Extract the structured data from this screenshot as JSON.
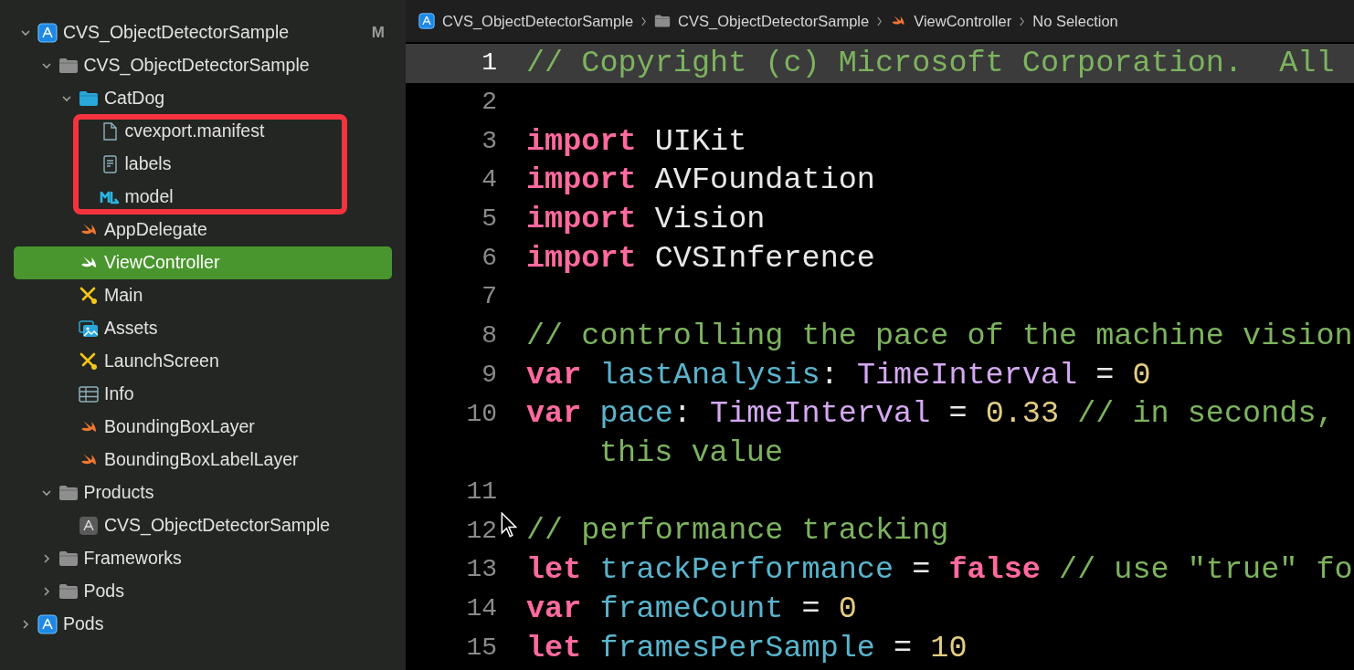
{
  "navigator": {
    "tree": [
      {
        "label": "CVS_ObjectDetectorSample",
        "kind": "app",
        "expanded": true,
        "badge": "M",
        "selected": false,
        "children": [
          {
            "label": "CVS_ObjectDetectorSample",
            "kind": "folder",
            "expanded": true,
            "selected": false,
            "children": [
              {
                "label": "CatDog",
                "kind": "group",
                "expanded": true,
                "selected": false,
                "highlighted": true,
                "children": [
                  {
                    "label": "cvexport.manifest",
                    "kind": "doc",
                    "selected": false
                  },
                  {
                    "label": "labels",
                    "kind": "textdoc",
                    "selected": false
                  },
                  {
                    "label": "model",
                    "kind": "ml",
                    "selected": false
                  }
                ]
              },
              {
                "label": "AppDelegate",
                "kind": "swift",
                "selected": false
              },
              {
                "label": "ViewController",
                "kind": "swift",
                "selected": true
              },
              {
                "label": "Main",
                "kind": "storyboard",
                "selected": false
              },
              {
                "label": "Assets",
                "kind": "assets",
                "selected": false
              },
              {
                "label": "LaunchScreen",
                "kind": "storyboard",
                "selected": false
              },
              {
                "label": "Info",
                "kind": "plist",
                "selected": false
              },
              {
                "label": "BoundingBoxLayer",
                "kind": "swift",
                "selected": false
              },
              {
                "label": "BoundingBoxLabelLayer",
                "kind": "swift",
                "selected": false
              }
            ]
          },
          {
            "label": "Products",
            "kind": "folder",
            "expanded": true,
            "selected": false,
            "children": [
              {
                "label": "CVS_ObjectDetectorSample",
                "kind": "product",
                "selected": false
              }
            ]
          },
          {
            "label": "Frameworks",
            "kind": "folder",
            "expanded": false,
            "selected": false
          },
          {
            "label": "Pods",
            "kind": "folder",
            "expanded": false,
            "selected": false
          }
        ]
      },
      {
        "label": "Pods",
        "kind": "app",
        "expanded": false,
        "selected": false
      }
    ]
  },
  "breadcrumb": [
    {
      "label": "CVS_ObjectDetectorSample",
      "kind": "app"
    },
    {
      "label": "CVS_ObjectDetectorSample",
      "kind": "folder"
    },
    {
      "label": "ViewController",
      "kind": "swift"
    },
    {
      "label": "No Selection",
      "kind": "text"
    }
  ],
  "editor": {
    "lines": [
      {
        "number": "1",
        "current": true,
        "tokens": [
          {
            "kind": "comment",
            "text": "// Copyright (c) Microsoft Corporation.  All"
          }
        ]
      },
      {
        "number": "2",
        "current": false
      },
      {
        "number": "3",
        "current": false,
        "tokens": [
          {
            "kind": "keyword",
            "text": "import"
          },
          {
            "kind": "plain",
            "text": " UIKit"
          }
        ]
      },
      {
        "number": "4",
        "current": false,
        "tokens": [
          {
            "kind": "keyword",
            "text": "import"
          },
          {
            "kind": "plain",
            "text": " AVFoundation"
          }
        ]
      },
      {
        "number": "5",
        "current": false,
        "tokens": [
          {
            "kind": "keyword",
            "text": "import"
          },
          {
            "kind": "plain",
            "text": " Vision"
          }
        ]
      },
      {
        "number": "6",
        "current": false,
        "tokens": [
          {
            "kind": "keyword",
            "text": "import"
          },
          {
            "kind": "plain",
            "text": " CVSInference"
          }
        ]
      },
      {
        "number": "7",
        "current": false
      },
      {
        "number": "8",
        "current": false,
        "tokens": [
          {
            "kind": "comment",
            "text": "// controlling the pace of the machine vision"
          }
        ]
      },
      {
        "number": "9",
        "current": false,
        "tokens": [
          {
            "kind": "keyword",
            "text": "var"
          },
          {
            "kind": "ident",
            "text": " lastAnalysis"
          },
          {
            "kind": "plain",
            "text": ": "
          },
          {
            "kind": "type",
            "text": "TimeInterval"
          },
          {
            "kind": "plain",
            "text": " = "
          },
          {
            "kind": "number",
            "text": "0"
          }
        ]
      },
      {
        "number": "10",
        "current": false,
        "tokens": [
          {
            "kind": "keyword",
            "text": "var"
          },
          {
            "kind": "ident",
            "text": " pace"
          },
          {
            "kind": "plain",
            "text": ": "
          },
          {
            "kind": "type",
            "text": "TimeInterval"
          },
          {
            "kind": "plain",
            "text": " = "
          },
          {
            "kind": "number",
            "text": "0.33"
          },
          {
            "kind": "comment",
            "text": " // in seconds,"
          }
        ],
        "wrap": [
          {
            "kind": "comment",
            "text": "this value"
          }
        ]
      },
      {
        "number": "11",
        "current": false
      },
      {
        "number": "12",
        "current": false,
        "cursor": true,
        "tokens": [
          {
            "kind": "comment",
            "text": "// performance tracking"
          }
        ]
      },
      {
        "number": "13",
        "current": false,
        "tokens": [
          {
            "kind": "keyword",
            "text": "let"
          },
          {
            "kind": "ident",
            "text": " trackPerformance"
          },
          {
            "kind": "plain",
            "text": " = "
          },
          {
            "kind": "keyword",
            "text": "false"
          },
          {
            "kind": "comment",
            "text": " // use \"true\" fo"
          }
        ]
      },
      {
        "number": "14",
        "current": false,
        "tokens": [
          {
            "kind": "keyword",
            "text": "var"
          },
          {
            "kind": "ident",
            "text": " frameCount"
          },
          {
            "kind": "plain",
            "text": " = "
          },
          {
            "kind": "number",
            "text": "0"
          }
        ]
      },
      {
        "number": "15",
        "current": false,
        "tokens": [
          {
            "kind": "keyword",
            "text": "let"
          },
          {
            "kind": "ident",
            "text": " framesPerSample"
          },
          {
            "kind": "plain",
            "text": " = "
          },
          {
            "kind": "number",
            "text": "10"
          }
        ]
      }
    ]
  }
}
